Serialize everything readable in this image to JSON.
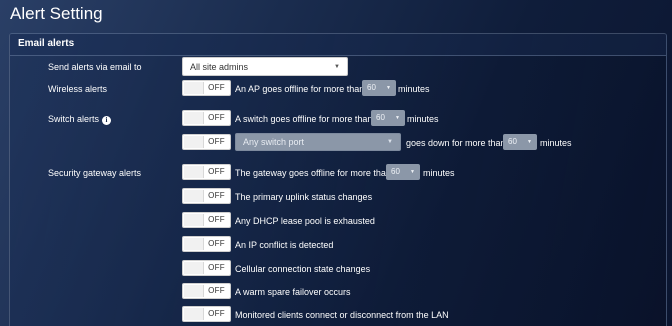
{
  "page_title": "Alert Setting",
  "panel": {
    "title": "Email alerts"
  },
  "send_via_email": {
    "label": "Send alerts via email to",
    "value": "All site admins"
  },
  "wireless": {
    "label": "Wireless alerts",
    "toggle": "OFF",
    "text_before": "An AP goes offline for more than",
    "minutes_value": "60",
    "text_after": "minutes"
  },
  "switch": {
    "label": "Switch alerts",
    "info_icon": "i",
    "row1": {
      "toggle": "OFF",
      "text_before": "A switch goes offline for more than",
      "minutes_value": "60",
      "text_after": "minutes"
    },
    "row2": {
      "toggle": "OFF",
      "port_placeholder": "Any switch port",
      "text_before": "goes down for more than",
      "minutes_value": "60",
      "text_after": "minutes"
    }
  },
  "security": {
    "label": "Security gateway alerts",
    "row1": {
      "toggle": "OFF",
      "text_before": "The gateway goes offline for more than",
      "minutes_value": "60",
      "text_after": "minutes"
    },
    "items": [
      {
        "toggle": "OFF",
        "text": "The primary uplink status changes"
      },
      {
        "toggle": "OFF",
        "text": "Any DHCP lease pool is exhausted"
      },
      {
        "toggle": "OFF",
        "text": "An IP conflict is detected"
      },
      {
        "toggle": "OFF",
        "text": "Cellular connection state changes"
      },
      {
        "toggle": "OFF",
        "text": "A warm spare failover occurs"
      },
      {
        "toggle": "OFF",
        "text": "Monitored clients connect or disconnect from the LAN"
      }
    ]
  },
  "icons": {
    "caret": "caret-down-icon",
    "info": "info-icon"
  }
}
